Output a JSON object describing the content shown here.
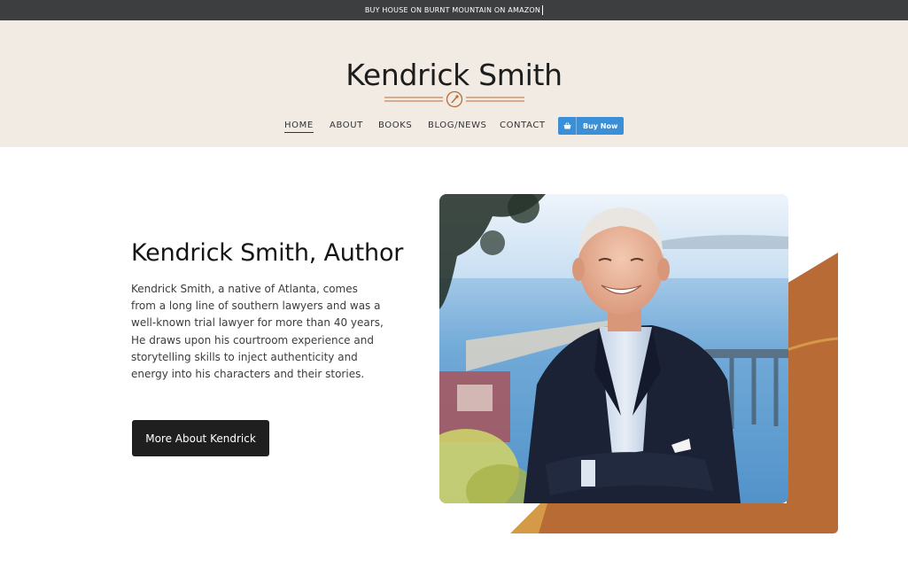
{
  "announcement": {
    "text": "BUY HOUSE ON BURNT MOUNTAIN ON AMAZON"
  },
  "header": {
    "site_title": "Kendrick Smith",
    "ornament_icon": "feather-seal-icon",
    "nav": [
      {
        "label": "HOME",
        "active": true
      },
      {
        "label": "ABOUT"
      },
      {
        "label": "BOOKS"
      },
      {
        "label": "BLOG/NEWS"
      },
      {
        "label": "CONTACT"
      }
    ],
    "buy_button": {
      "label": "Buy Now",
      "icon": "shopping-basket-icon"
    }
  },
  "hero": {
    "headline": "Kendrick Smith, Author",
    "bio_lines": [
      "Kendrick Smith, a native of Atlanta, comes",
      "from a long line of southern lawyers and was a",
      "well-known trial lawyer for more than 40 years,",
      "He draws upon his courtroom experience and",
      "storytelling skills to inject authenticity and",
      "energy into his characters and their stories."
    ],
    "cta_label": "More About Kendrick"
  },
  "colors": {
    "topbar": "#3d3e40",
    "header_bg": "#f1ebe4",
    "accent_copper": "#b96b35",
    "accent_gold": "#d49a48",
    "button_blue": "#3b8fd6",
    "cta_dark": "#1f1f1f"
  }
}
